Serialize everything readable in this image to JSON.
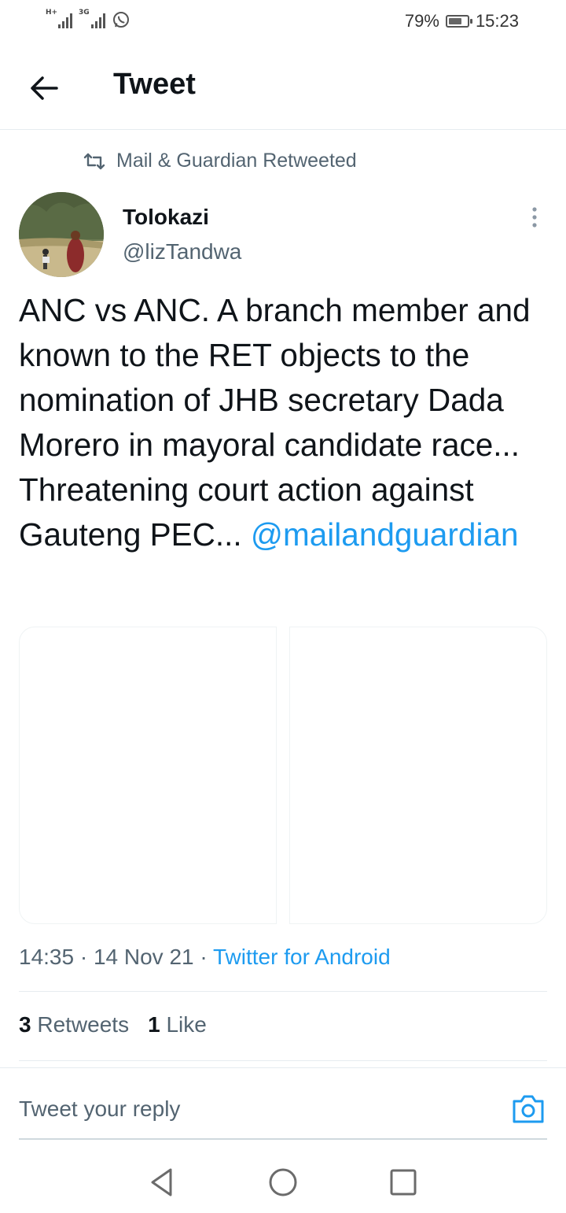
{
  "status_bar": {
    "network1": "H+",
    "network2": "3G",
    "battery": "79%",
    "battery_level": 0.79,
    "time": "15:23",
    "icons": [
      "signal-icon",
      "whatsapp-icon",
      "battery-icon"
    ]
  },
  "header": {
    "title": "Tweet",
    "back_icon": "arrow-left-icon"
  },
  "retweet_context": {
    "text": "Mail & Guardian Retweeted",
    "icon": "retweet-icon"
  },
  "author": {
    "name": "Tolokazi",
    "handle": "@lizTandwa"
  },
  "tweet": {
    "text": "ANC vs ANC. A branch member and known to the RET objects to the nomination of JHB secretary Dada Morero in mayoral candidate race... Threatening court action against Gauteng PEC... ",
    "mention": "@mailandguardian"
  },
  "meta": {
    "time": "14:35",
    "date": "14 Nov 21",
    "source": "Twitter for Android"
  },
  "stats": {
    "retweets_count": "3",
    "retweets_label": "Retweets",
    "likes_count": "1",
    "likes_label": "Like"
  },
  "reply": {
    "placeholder": "Tweet your reply",
    "icon": "camera-icon"
  },
  "colors": {
    "accent": "#1d9bf0",
    "secondary_text": "#536471",
    "primary_text": "#0f1419"
  }
}
